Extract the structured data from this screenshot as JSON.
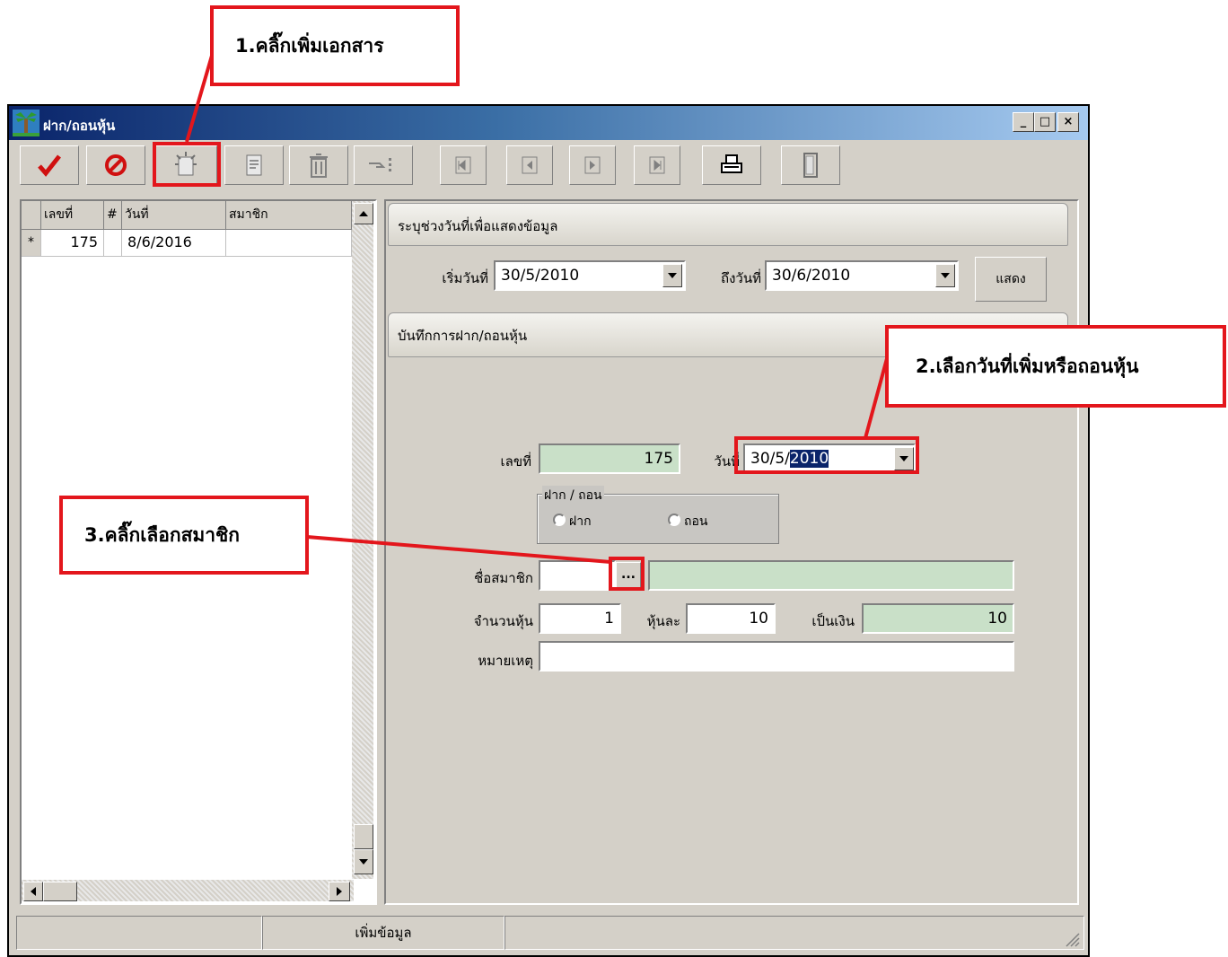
{
  "window": {
    "title": "ฝาก/ถอนหุ้น",
    "caption_buttons": [
      "_",
      "□",
      "×"
    ]
  },
  "toolbar": {
    "buttons": [
      {
        "name": "save",
        "icon": "check-icon"
      },
      {
        "name": "cancel",
        "icon": "prohibit-icon"
      },
      {
        "name": "add-document",
        "icon": "new-document-icon"
      },
      {
        "name": "edit",
        "icon": "edit-document-icon"
      },
      {
        "name": "delete",
        "icon": "trash-icon"
      },
      {
        "name": "search",
        "icon": "pointer-list-icon"
      },
      {
        "name": "first",
        "icon": "first-record-icon"
      },
      {
        "name": "previous",
        "icon": "previous-record-icon"
      },
      {
        "name": "next",
        "icon": "next-record-icon"
      },
      {
        "name": "last",
        "icon": "last-record-icon"
      },
      {
        "name": "print",
        "icon": "printer-icon"
      },
      {
        "name": "exit",
        "icon": "door-icon"
      }
    ]
  },
  "grid": {
    "columns": [
      "เลขที่",
      "#",
      "วันที่",
      "สมาชิก"
    ],
    "rows": [
      {
        "marker": "*",
        "number": "175",
        "flag": "",
        "date": "8/6/2016",
        "member": ""
      }
    ]
  },
  "range_section": {
    "title": "ระบุช่วงวันที่เพื่อแสดงข้อมูล",
    "start_label": "เริ่มวันที่",
    "start_value": "30/5/2010",
    "end_label": "ถึงวันที่",
    "end_value": "30/6/2010",
    "show_button": "แสดง"
  },
  "record_section": {
    "title": "บันทึกการฝาก/ถอนหุ้น",
    "number_label": "เลขที่",
    "number_value": "175",
    "date_label": "วันที่",
    "date_value_plain": "30/5/",
    "date_value_selected": "2010",
    "type_group_label": "ฝาก / ถอน",
    "type_deposit": "ฝาก",
    "type_withdraw": "ถอน",
    "member_label": "ชื่อสมาชิก",
    "member_code": "",
    "member_browse": "...",
    "member_name": "",
    "shares_label": "จำนวนหุ้น",
    "shares_value": "1",
    "per_share_label": "หุ้นละ",
    "per_share_value": "10",
    "amount_label": "เป็นเงิน",
    "amount_value": "10",
    "note_label": "หมายเหตุ",
    "note_value": ""
  },
  "statusbar": {
    "cells": [
      "",
      "เพิ่มข้อมูล",
      ""
    ]
  },
  "annotations": {
    "step1": "1.คลิ๊กเพิ่มเอกสาร",
    "step2": "2.เลือกวันที่เพิ่มหรือถอนหุ้น",
    "step3": "3.คลิ๊กเลือกสมาชิก",
    "color": "#e3161c"
  }
}
